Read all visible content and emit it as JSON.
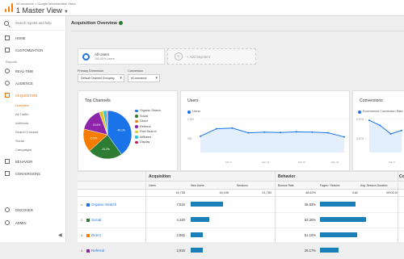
{
  "header": {
    "breadcrumb": "All accounts > Google Merchandise Store",
    "view_name": "1 Master View",
    "view_caret": "▼"
  },
  "sidebar": {
    "search_placeholder": "Search reports and help",
    "items_top": [
      {
        "label": "HOME",
        "icon": "home-icon"
      },
      {
        "label": "CUSTOMIZATION",
        "icon": "grid-icon"
      }
    ],
    "reports_label": "Reports",
    "items_reports": [
      {
        "label": "REAL-TIME",
        "icon": "clock-icon"
      },
      {
        "label": "AUDIENCE",
        "icon": "person-icon"
      },
      {
        "label": "ACQUISITION",
        "icon": "acquisition-icon"
      }
    ],
    "acquisition_sub": [
      "Overview",
      "All Traffic",
      "AdWords",
      "Search Console",
      "Social",
      "Campaigns"
    ],
    "items_after": [
      {
        "label": "BEHAVIOR",
        "icon": "behavior-icon"
      },
      {
        "label": "CONVERSIONS",
        "icon": "flag-icon"
      }
    ],
    "items_bottom": [
      {
        "label": "DISCOVER",
        "icon": "lightbulb-icon"
      },
      {
        "label": "ADMIN",
        "icon": "gear-icon"
      }
    ],
    "collapse_glyph": "◀"
  },
  "main": {
    "title": "Acquisition Overview",
    "segment": {
      "name": "All Users",
      "pct": "100.00% Users"
    },
    "add_segment": "+ Add Segment",
    "primary_dimension_label": "Primary Dimension",
    "conversion_label": "Conversion",
    "primary_dimension_value": "Default Channel Grouping",
    "conversion_value": "eCommerce",
    "dropdown_caret": "▾"
  },
  "top_channels": {
    "title": "Top Channels",
    "legend": [
      {
        "name": "Organic Search",
        "color": "#1a73e8"
      },
      {
        "name": "Social",
        "color": "#2e7d32"
      },
      {
        "name": "Direct",
        "color": "#f57c00"
      },
      {
        "name": "Referral",
        "color": "#8e24aa"
      },
      {
        "name": "Paid Search",
        "color": "#e6c229"
      },
      {
        "name": "Affiliates",
        "color": "#26c6da"
      },
      {
        "name": "Display",
        "color": "#c2185b"
      }
    ]
  },
  "users_card": {
    "title": "Users",
    "series": "Users",
    "yticks": [
      "1,000",
      "500"
    ],
    "xticks": [
      "...",
      "Mar 8",
      "Mar 15",
      "Mar 22",
      "Mar 29"
    ]
  },
  "conversions_card": {
    "title": "Conversions",
    "series": "Ecommerce Conversion Rate",
    "yticks": [
      "0.20%",
      "0.10%"
    ],
    "xticks": [
      "...",
      "Mar 8"
    ]
  },
  "chart_data": [
    {
      "type": "pie",
      "title": "Top Channels",
      "categories": [
        "Organic Search",
        "Social",
        "Direct",
        "Referral",
        "Paid Search",
        "Affiliates",
        "Display"
      ],
      "values": [
        40.1,
        23.2,
        15.5,
        15.6,
        2.8,
        2.3,
        0.5
      ],
      "slice_labels": [
        "40.1%",
        "23.2%",
        "15.5%",
        "15.6%",
        "",
        "",
        ""
      ]
    },
    {
      "type": "line",
      "title": "Users",
      "x": [
        "Mar 1",
        "Mar 4",
        "Mar 8",
        "Mar 11",
        "Mar 15",
        "Mar 18",
        "Mar 22",
        "Mar 25",
        "Mar 29",
        "Mar 31"
      ],
      "series": [
        {
          "name": "Users",
          "values": [
            480,
            700,
            720,
            580,
            600,
            590,
            610,
            600,
            580,
            460
          ]
        }
      ],
      "ylim": [
        0,
        1000
      ]
    },
    {
      "type": "line",
      "title": "Conversions",
      "x": [
        "Mar 1",
        "Mar 4",
        "Mar 8",
        "Mar 11"
      ],
      "series": [
        {
          "name": "Ecommerce Conversion Rate",
          "values": [
            0.19,
            0.16,
            0.11,
            0.13
          ]
        }
      ],
      "ylim": [
        0,
        0.2
      ]
    }
  ],
  "table": {
    "group_acq": "Acquisition",
    "group_beh": "Behavior",
    "group_conv": "Co",
    "columns": [
      "Users",
      "New Users",
      "Sessions",
      "Bounce Rate",
      "Pages / Session",
      "Avg. Session Duration"
    ],
    "totals": [
      "16,735",
      "16,105",
      "21,780",
      "48.62%",
      "3.82",
      "00:02:03"
    ],
    "rows": [
      {
        "num": "1.",
        "name": "Organic Search",
        "users": "7,515",
        "bounce": "48.93%",
        "color": "#1a73e8",
        "nu": 0.48,
        "br": 0.49
      },
      {
        "num": "2.",
        "name": "Social",
        "users": "4,340",
        "bounce": "63.30%",
        "color": "#2e7d32",
        "nu": 0.27,
        "br": 0.63
      },
      {
        "num": "3.",
        "name": "Direct",
        "users": "2,862",
        "bounce": "51.10%",
        "color": "#f57c00",
        "nu": 0.18,
        "br": 0.51
      },
      {
        "num": "4.",
        "name": "Referral",
        "users": "2,915",
        "bounce": "26.17%",
        "color": "#8e24aa",
        "nu": 0.18,
        "br": 0.26
      }
    ]
  }
}
